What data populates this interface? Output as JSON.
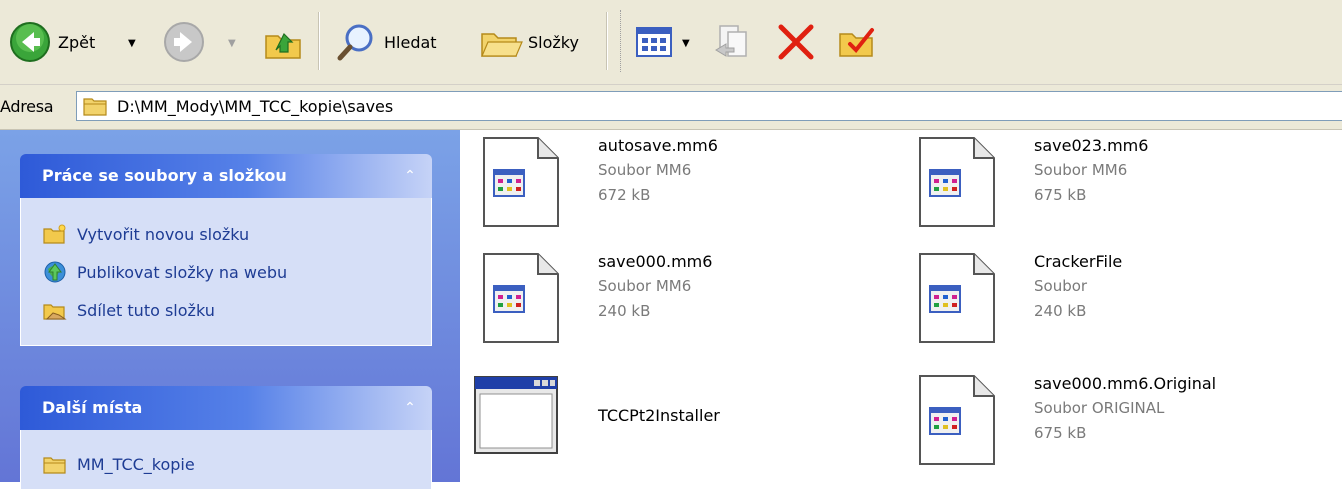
{
  "toolbar": {
    "back_label": "Zpět",
    "search_label": "Hledat",
    "folders_label": "Složky"
  },
  "address": {
    "label": "Adresa",
    "path": "D:\\MM_Mody\\MM_TCC_kopie\\saves"
  },
  "taskpane": {
    "file_tasks": {
      "title": "Práce se soubory a složkou",
      "items": [
        {
          "label": "Vytvořit novou složku",
          "icon": "new-folder-icon"
        },
        {
          "label": "Publikovat složky na webu",
          "icon": "publish-web-icon"
        },
        {
          "label": "Sdílet tuto složku",
          "icon": "share-folder-icon"
        }
      ]
    },
    "other_places": {
      "title": "Další místa",
      "items": [
        {
          "label": "MM_TCC_kopie",
          "icon": "folder-icon"
        }
      ]
    }
  },
  "files": [
    {
      "name": "autosave.mm6",
      "type": "Soubor MM6",
      "size": "672 kB",
      "icon": "document-icon"
    },
    {
      "name": "save023.mm6",
      "type": "Soubor MM6",
      "size": "675 kB",
      "icon": "document-icon"
    },
    {
      "name": "save000.mm6",
      "type": "Soubor MM6",
      "size": "240 kB",
      "icon": "document-icon"
    },
    {
      "name": "CrackerFile",
      "type": "Soubor",
      "size": "240 kB",
      "icon": "document-icon"
    },
    {
      "name": "TCCPt2Installer",
      "type": "",
      "size": "",
      "icon": "application-icon"
    },
    {
      "name": "save000.mm6.Original",
      "type": "Soubor ORIGINAL",
      "size": "675 kB",
      "icon": "document-icon"
    }
  ],
  "colors": {
    "taskpane_bg": "#6f8ee0",
    "taskpane_header": "#2e5ad8",
    "link_text": "#1e3c94",
    "delete_red": "#e02010"
  }
}
